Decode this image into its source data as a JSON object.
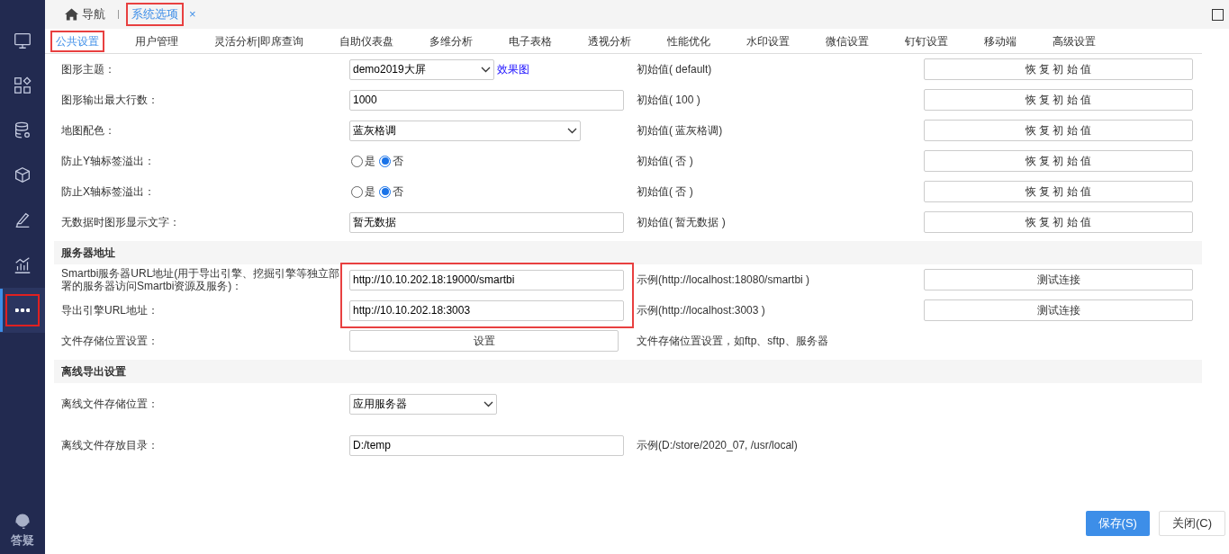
{
  "sidebar": {
    "items": [
      {
        "selected": false,
        "highlighted": false
      },
      {
        "selected": false,
        "highlighted": false
      },
      {
        "selected": false,
        "highlighted": false
      },
      {
        "selected": false,
        "highlighted": false
      },
      {
        "selected": false,
        "highlighted": false
      },
      {
        "selected": false,
        "highlighted": false
      },
      {
        "selected": true,
        "highlighted": true
      }
    ],
    "help": {
      "label": "答疑"
    }
  },
  "top_tabs": [
    {
      "label": "导航",
      "selected": false,
      "highlighted": false
    },
    {
      "label": "系统选项",
      "selected": true,
      "highlighted": true,
      "close": "×"
    }
  ],
  "tabs": [
    {
      "label": "公共设置",
      "selected": true,
      "highlighted": true
    },
    {
      "label": "用户管理",
      "selected": false,
      "highlighted": false
    },
    {
      "label": "灵活分析|即席查询",
      "selected": false,
      "highlighted": false
    },
    {
      "label": "自助仪表盘",
      "selected": false,
      "highlighted": false
    },
    {
      "label": "多维分析",
      "selected": false,
      "highlighted": false
    },
    {
      "label": "电子表格",
      "selected": false,
      "highlighted": false
    },
    {
      "label": "透视分析",
      "selected": false,
      "highlighted": false
    },
    {
      "label": "性能优化",
      "selected": false,
      "highlighted": false
    },
    {
      "label": "水印设置",
      "selected": false,
      "highlighted": false
    },
    {
      "label": "微信设置",
      "selected": false,
      "highlighted": false
    },
    {
      "label": "钉钉设置",
      "selected": false,
      "highlighted": false
    },
    {
      "label": "移动端",
      "selected": false,
      "highlighted": false
    },
    {
      "label": "高级设置",
      "selected": false,
      "highlighted": false
    }
  ],
  "sections": [
    {
      "rows": [
        {
          "label": "图形主题：",
          "kind": "select",
          "value": "demo2019大屏",
          "link": "效果图",
          "note": "初始值( default)",
          "button": "恢 复 初 始 值"
        },
        {
          "label": "图形输出最大行数：",
          "kind": "input",
          "value": "1000",
          "note": "初始值( 100 )",
          "button": "恢 复 初 始 值"
        },
        {
          "label": "地图配色：",
          "kind": "select",
          "value": "蓝灰格调",
          "note": "初始值( 蓝灰格调)",
          "button": "恢 复 初 始 值"
        },
        {
          "label": "防止Y轴标签溢出：",
          "kind": "radio",
          "options": [
            {
              "label": "是",
              "selected": false
            },
            {
              "label": "否",
              "selected": true
            }
          ],
          "note": "初始值( 否 )",
          "button": "恢 复 初 始 值"
        },
        {
          "label": "防止X轴标签溢出：",
          "kind": "radio",
          "options": [
            {
              "label": "是",
              "selected": false
            },
            {
              "label": "否",
              "selected": true
            }
          ],
          "note": "初始值( 否 )",
          "button": "恢 复 初 始 值"
        },
        {
          "label": "无数据时图形显示文字：",
          "kind": "input",
          "value": "暂无数据",
          "note": "初始值( 暂无数据 )",
          "button": "恢 复 初 始 值"
        }
      ]
    },
    {
      "title": "服务器地址",
      "rows": [
        {
          "label": "Smartbi服务器URL地址(用于导出引擎、挖掘引擎等独立部署的服务器访问Smartbi资源及服务)：",
          "kind": "input",
          "value": "http://10.10.202.18:19000/smartbi",
          "highlighted": true,
          "note": "示例(http://localhost:18080/smartbi )",
          "button": "测试连接"
        },
        {
          "label": "导出引擎URL地址：",
          "kind": "input",
          "value": "http://10.10.202.18:3003",
          "highlighted": true,
          "note": "示例(http://localhost:3003 )",
          "button": "测试连接"
        },
        {
          "label": "文件存储位置设置：",
          "kind": "button",
          "value": "设置",
          "note": "文件存储位置设置，如ftp、sftp、服务器"
        }
      ]
    },
    {
      "title": "离线导出设置",
      "rows": [
        {
          "label": "离线文件存储位置：",
          "kind": "select",
          "value": "应用服务器"
        },
        {
          "label": "离线文件存放目录：",
          "kind": "input",
          "value": "D:/temp",
          "note": "示例(D:/store/2020_07, /usr/local)"
        }
      ]
    }
  ],
  "footer": {
    "buttons": [
      {
        "label": "保存(S)",
        "primary": true
      },
      {
        "label": "关闭(C)",
        "primary": false
      }
    ]
  }
}
